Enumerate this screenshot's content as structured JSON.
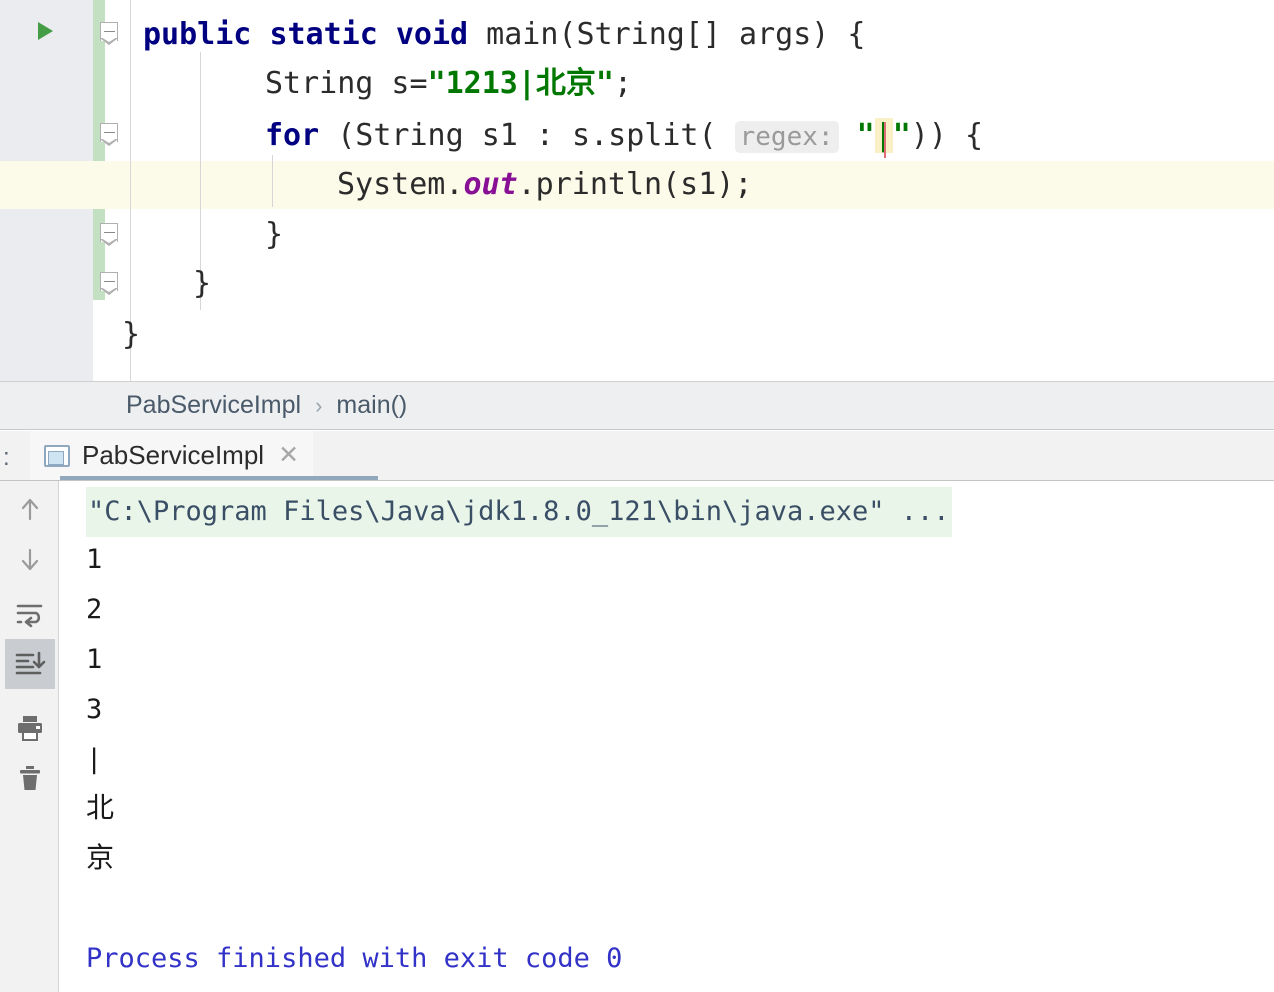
{
  "editor": {
    "run_gutter_icon": "run-arrow-icon",
    "fold_icon": "fold-minus-icon",
    "lines": [
      {
        "id": 0,
        "indent": 0,
        "text": "public static void main(String[] args) {"
      },
      {
        "id": 1,
        "indent": 1,
        "text": "String s=\"1213|北京\";"
      },
      {
        "id": 2,
        "indent": 1,
        "text": "for (String s1 : s.split( regex: \"|\")) {"
      },
      {
        "id": 3,
        "indent": 2,
        "text": "System.out.println(s1);"
      },
      {
        "id": 4,
        "indent": 2,
        "text": "}"
      },
      {
        "id": 5,
        "indent": 1,
        "text": "}"
      },
      {
        "id": 6,
        "indent": 0,
        "text": "}"
      }
    ],
    "tokens": {
      "kw_public": "public",
      "kw_static": "static",
      "kw_void": "void",
      "kw_for": "for",
      "main_sig": " main(String[] args) {",
      "string_decl_prefix": "String s=",
      "string_literal": "\"1213|北京\"",
      "string_decl_suffix": ";",
      "for_mid": " (String s1 : s.split( ",
      "param_hint": "regex:",
      "quote": "\"",
      "pipe": "|",
      "for_tail": ")) {",
      "sysout_prefix": "System.",
      "sysout_field": "out",
      "sysout_suffix": ".println(s1);",
      "brace_close": "}"
    }
  },
  "breadcrumb": {
    "class": "PabServiceImpl",
    "separator": "›",
    "method": "main()"
  },
  "run_tab": {
    "dots": ":",
    "icon": "console-window-icon",
    "label": "PabServiceImpl",
    "close": "✕"
  },
  "console": {
    "toolbar": [
      {
        "name": "up-arrow-icon",
        "label": "Up the stack trace",
        "active": false
      },
      {
        "name": "down-arrow-icon",
        "label": "Down the stack trace",
        "active": false
      },
      {
        "name": "soft-wrap-icon",
        "label": "Soft-Wrap",
        "active": false
      },
      {
        "name": "scroll-to-end-icon",
        "label": "Scroll to the end",
        "active": true
      },
      {
        "name": "print-icon",
        "label": "Print",
        "active": false
      },
      {
        "name": "trash-icon",
        "label": "Clear All",
        "active": false
      }
    ],
    "command_line": "\"C:\\Program Files\\Java\\jdk1.8.0_121\\bin\\java.exe\" ...",
    "output": [
      "1",
      "2",
      "1",
      "3",
      "|",
      "北",
      "京"
    ],
    "exit_message": "Process finished with exit code 0"
  },
  "colors": {
    "keyword": "#000080",
    "string": "#007700",
    "field": "#871094",
    "caret_row": "#fcfae8",
    "change_stripe": "#c3e0c3",
    "command_bg": "#e9f5e9",
    "exit_text": "#3232c8",
    "run_arrow": "#449d44",
    "tab_underline": "#91a7bc"
  }
}
